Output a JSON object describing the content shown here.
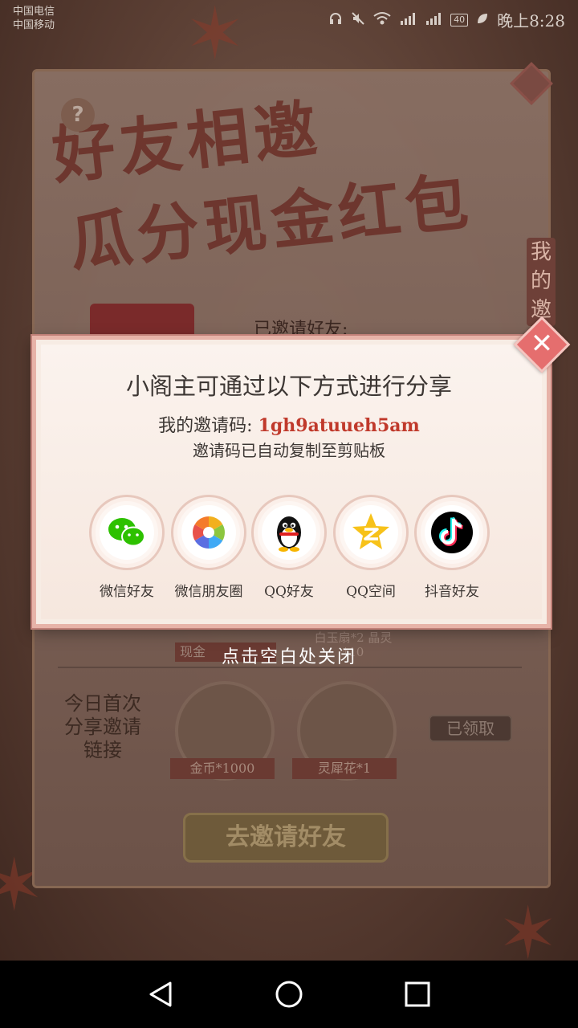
{
  "status_bar": {
    "carrier_1": "中国电信",
    "carrier_2": "中国移动",
    "battery": "40",
    "time": "晚上8:28",
    "icons": [
      "headphones-icon",
      "mute-icon",
      "wifi-icon",
      "signal-4g-icon",
      "signal-2g-icon",
      "battery-icon",
      "leaf-icon"
    ]
  },
  "background_page": {
    "title_line1": "好友相邀",
    "title_line2": "瓜分现金红包",
    "side_tag": "我的邀",
    "invited_label": "已邀请好友:",
    "task_label": "今日首次分享邀请链接",
    "reward_1_label": "金币*1000",
    "reward_2_label": "灵犀花*1",
    "claimed_button": "已领取",
    "invite_button": "去邀请好友",
    "row1_reward_a": "现金",
    "row1_reward_b": "白玉扇*2 晶灵*10"
  },
  "modal": {
    "title": "小阁主可通过以下方式进行分享",
    "code_label": "我的邀请码:",
    "code_value": "1gh9atuueh5am",
    "copied_note": "邀请码已自动复制至剪贴板",
    "share_options": [
      {
        "label": "微信好友",
        "icon": "wechat-icon"
      },
      {
        "label": "微信朋友圈",
        "icon": "wechat-moments-icon"
      },
      {
        "label": "QQ好友",
        "icon": "qq-icon"
      },
      {
        "label": "QQ空间",
        "icon": "qzone-icon"
      },
      {
        "label": "抖音好友",
        "icon": "douyin-icon"
      }
    ]
  },
  "close_hint": "点击空白处关闭",
  "colors": {
    "accent_red": "#c0392b",
    "modal_border": "#e7b3a8",
    "close_button": "#e56e6e",
    "wechat_green": "#2dc100",
    "qzone_yellow": "#f7c21a"
  }
}
